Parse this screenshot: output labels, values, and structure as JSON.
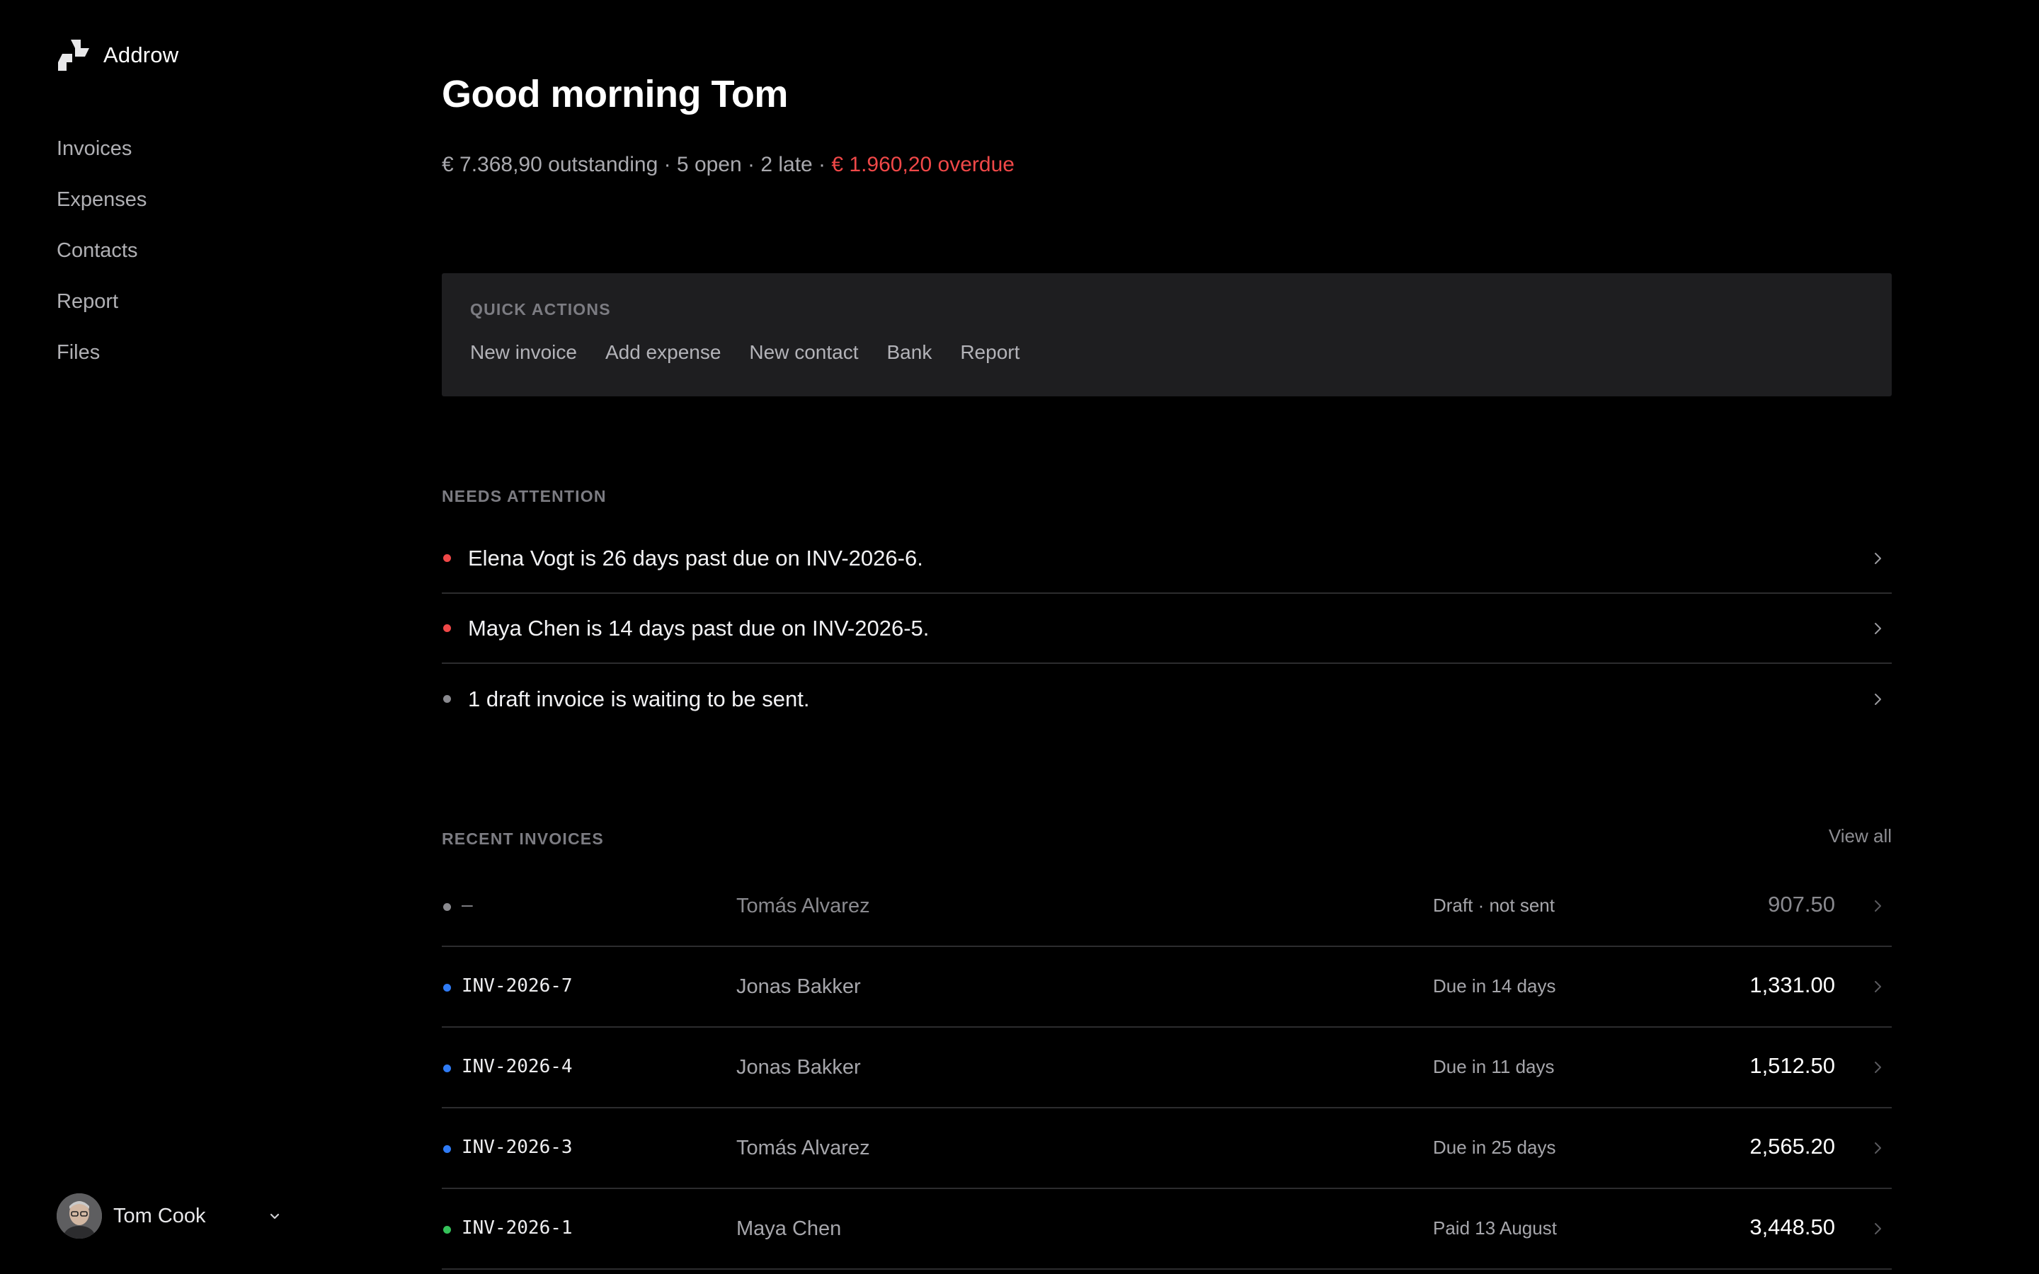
{
  "app": {
    "name": "Addrow"
  },
  "nav": {
    "items": [
      {
        "label": "Invoices"
      },
      {
        "label": "Expenses"
      },
      {
        "label": "Contacts"
      },
      {
        "label": "Report"
      },
      {
        "label": "Files"
      }
    ]
  },
  "user": {
    "name": "Tom Cook"
  },
  "header": {
    "greeting": "Good morning Tom",
    "summary": "€ 7.368,90 outstanding · 5 open · 2 late · ",
    "overdue": "€ 1.960,20 overdue"
  },
  "quick_actions": {
    "title": "QUICK ACTIONS",
    "items": [
      {
        "label": "New invoice"
      },
      {
        "label": "Add expense"
      },
      {
        "label": "New contact"
      },
      {
        "label": "Bank"
      },
      {
        "label": "Report"
      }
    ]
  },
  "attention": {
    "title": "NEEDS ATTENTION",
    "items": [
      {
        "text": "Elena Vogt is 26 days past due on INV-2026-6.",
        "color": "#f04848"
      },
      {
        "text": "Maya Chen is 14 days past due on INV-2026-5.",
        "color": "#f04848"
      },
      {
        "text": "1 draft invoice is waiting to be sent.",
        "color": "#8a8a8f"
      }
    ]
  },
  "recent": {
    "title": "RECENT INVOICES",
    "view_all": "View all",
    "rows": [
      {
        "number": "–",
        "contact": "Tomás Alvarez",
        "status": "Draft · not sent",
        "amount": "907.50",
        "color": "#8a8a8f"
      },
      {
        "number": "INV-2026-7",
        "contact": "Jonas Bakker",
        "status": "Due in 14 days",
        "amount": "1,331.00",
        "color": "#2f7bf5"
      },
      {
        "number": "INV-2026-4",
        "contact": "Jonas Bakker",
        "status": "Due in 11 days",
        "amount": "1,512.50",
        "color": "#2f7bf5"
      },
      {
        "number": "INV-2026-3",
        "contact": "Tomás Alvarez",
        "status": "Due in 25 days",
        "amount": "2,565.20",
        "color": "#2f7bf5"
      },
      {
        "number": "INV-2026-1",
        "contact": "Maya Chen",
        "status": "Paid 13 August",
        "amount": "3,448.50",
        "color": "#35c25a"
      }
    ]
  }
}
